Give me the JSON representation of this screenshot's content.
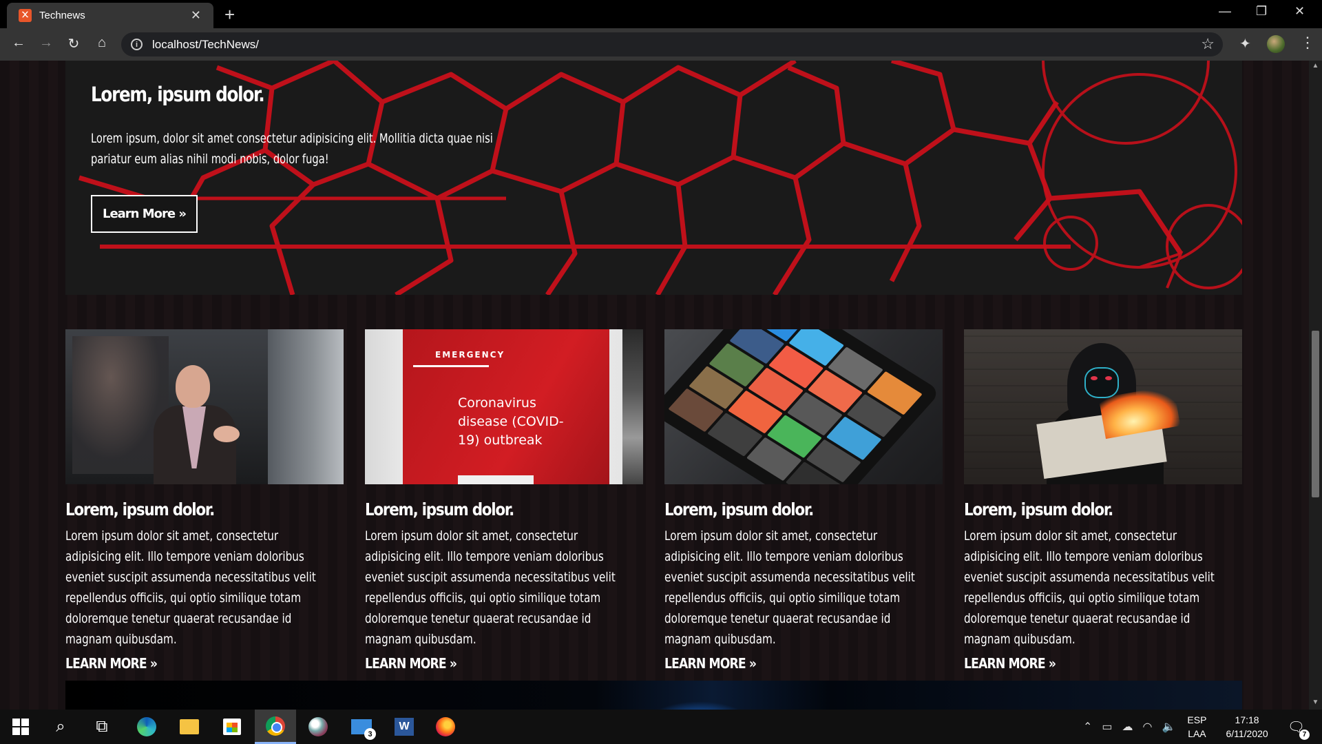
{
  "browser": {
    "tab_title": "Technews",
    "tab_favicon": "xampp-icon",
    "url": "localhost/TechNews/"
  },
  "hero": {
    "title": "Lorem, ipsum dolor.",
    "text": "Lorem ipsum, dolor sit amet consectetur adipisicing elit. Mollitia dicta quae nisi pariatur eum alias nihil modi nobis, dolor fuga!",
    "button_label": "Learn More »"
  },
  "cards": [
    {
      "image": "presenter-photo",
      "title": "Lorem, ipsum dolor.",
      "text": "Lorem ipsum dolor sit amet, consectetur adipisicing elit. Illo tempore veniam doloribus eveniet suscipit assumenda necessitatibus velit repellendus officiis, qui optio similique totam doloremque tenetur quaerat recusandae id magnam quibusdam.",
      "link_label": "LEARN MORE »"
    },
    {
      "image": "emergency-sign-photo",
      "image_text": {
        "header": "EMERGENCY",
        "body": "Coronavirus\ndisease (COVID-\n19) outbreak"
      },
      "title": "Lorem, ipsum dolor.",
      "text": "Lorem ipsum dolor sit amet, consectetur adipisicing elit. Illo tempore veniam doloribus eveniet suscipit assumenda necessitatibus velit repellendus officiis, qui optio similique totam doloremque tenetur quaerat recusandae id magnam quibusdam.",
      "link_label": "LEARN MORE »"
    },
    {
      "image": "tablet-photo",
      "title": "Lorem, ipsum dolor.",
      "text": "Lorem ipsum dolor sit amet, consectetur adipisicing elit. Illo tempore veniam doloribus eveniet suscipit assumenda necessitatibus velit repellendus officiis, qui optio similique totam doloremque tenetur quaerat recusandae id magnam quibusdam.",
      "link_label": "LEARN MORE »"
    },
    {
      "image": "hooded-figure-newspaper-photo",
      "title": "Lorem, ipsum dolor.",
      "text": "Lorem ipsum dolor sit amet, consectetur adipisicing elit. Illo tempore veniam doloribus eveniet suscipit assumenda necessitatibus velit repellendus officiis, qui optio similique totam doloremque tenetur quaerat recusandae id magnam quibusdam.",
      "link_label": "LEARN MORE »"
    }
  ],
  "taskbar": {
    "mail_badge": "3",
    "word_letter": "W",
    "lang_line1": "ESP",
    "lang_line2": "LAA",
    "time": "17:18",
    "date": "6/11/2020",
    "notifications_badge": "7"
  },
  "colors": {
    "hero_lines": "#c8101a",
    "page_bg": "#161012"
  }
}
